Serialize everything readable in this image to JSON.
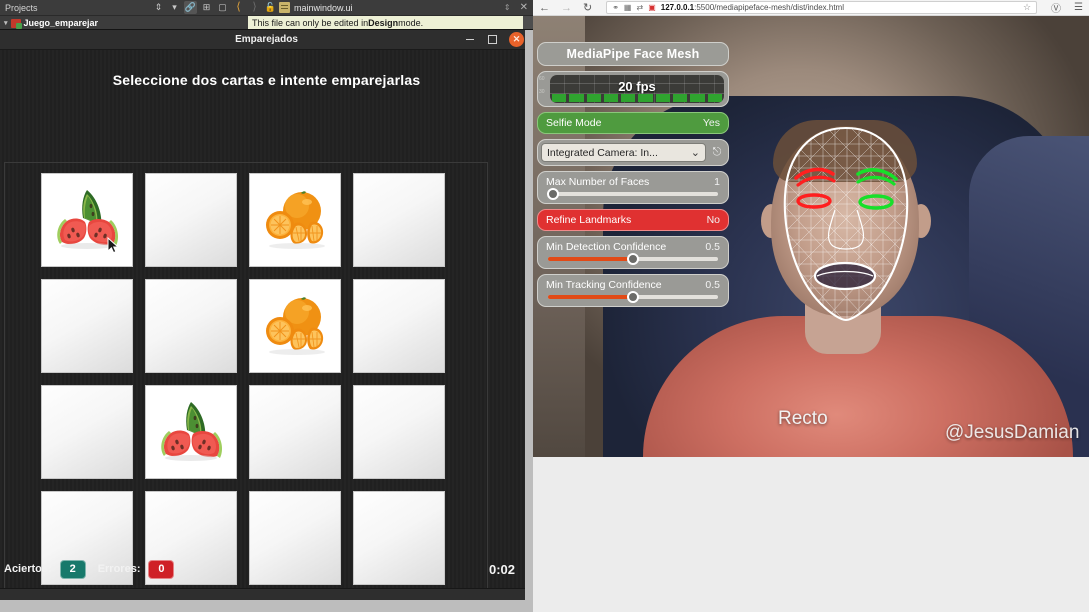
{
  "ide": {
    "projects_panel_label": "Projects",
    "project_node": "Juego_emparejar",
    "file_tab": "mainwindow.ui",
    "design_banner_prefix": "This file can only be edited in ",
    "design_banner_bold": "Design",
    "design_banner_suffix": " mode."
  },
  "app": {
    "window_title": "Emparejados",
    "heading": "Seleccione dos cartas e intente emparejarlas",
    "cards": [
      {
        "state": "faceup",
        "fruit": "watermelon",
        "cursor": true
      },
      {
        "state": "facedown",
        "fruit": ""
      },
      {
        "state": "faceup",
        "fruit": "orange"
      },
      {
        "state": "facedown",
        "fruit": ""
      },
      {
        "state": "facedown",
        "fruit": ""
      },
      {
        "state": "facedown",
        "fruit": ""
      },
      {
        "state": "faceup",
        "fruit": "orange"
      },
      {
        "state": "facedown",
        "fruit": ""
      },
      {
        "state": "facedown",
        "fruit": ""
      },
      {
        "state": "faceup",
        "fruit": "watermelon"
      },
      {
        "state": "facedown",
        "fruit": ""
      },
      {
        "state": "facedown",
        "fruit": ""
      },
      {
        "state": "facedown",
        "fruit": ""
      },
      {
        "state": "facedown",
        "fruit": ""
      },
      {
        "state": "facedown",
        "fruit": ""
      },
      {
        "state": "facedown",
        "fruit": ""
      }
    ],
    "status": {
      "hits_label": "Aciertos:",
      "hits_value": "2",
      "errors_label": "Errores:",
      "errors_value": "0",
      "timer": "0:02",
      "hits_color": "#17796b",
      "errors_color": "#cf2026"
    }
  },
  "browser": {
    "url_host": "127.0.0.1",
    "url_path": ":5500/mediapipeface-mesh/dist/index.html"
  },
  "mediapipe": {
    "title": "MediaPipe Face Mesh",
    "fps": {
      "value": "20 fps",
      "axis_high": "60",
      "axis_low": "30",
      "bars": [
        1,
        1,
        1,
        1,
        1,
        1,
        1,
        1,
        1,
        1
      ]
    },
    "selfie_mode": {
      "label": "Selfie Mode",
      "value": "Yes",
      "color": "#4f9b3f"
    },
    "camera_select": {
      "value": "Integrated Camera: In..."
    },
    "sliders": [
      {
        "label": "Max Number of Faces",
        "value": "1",
        "pct": 3,
        "filled": false
      },
      {
        "label": "Min Detection Confidence",
        "value": "0.5",
        "pct": 50,
        "filled": true
      },
      {
        "label": "Min Tracking Confidence",
        "value": "0.5",
        "pct": 50,
        "filled": true
      }
    ],
    "refine_landmarks": {
      "label": "Refine Landmarks",
      "value": "No",
      "color": "#e03131"
    }
  },
  "video": {
    "pose_label": "Recto",
    "watermark": "@JesusDamian"
  }
}
